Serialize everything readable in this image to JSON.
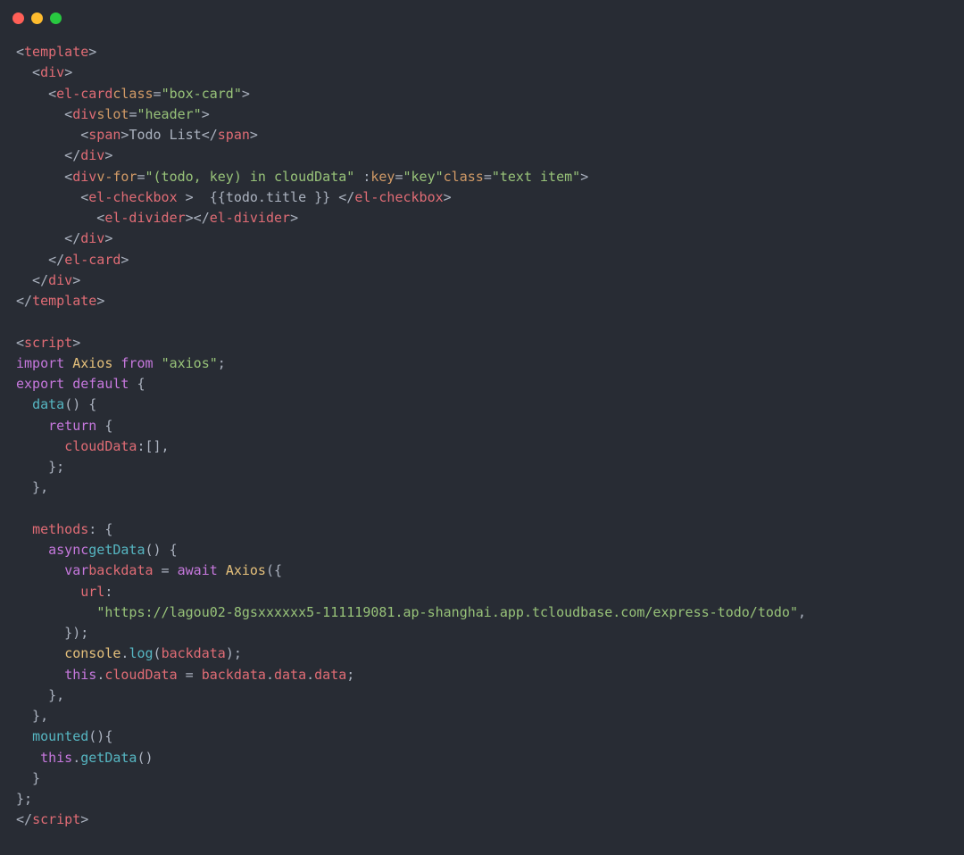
{
  "code": {
    "lines": [
      [
        [
          "p",
          "<"
        ],
        [
          "tag",
          "template"
        ],
        [
          "p",
          ">"
        ]
      ],
      [
        [
          "p",
          "  <"
        ],
        [
          "tag",
          "div"
        ],
        [
          "p",
          ">"
        ]
      ],
      [
        [
          "p",
          "    <"
        ],
        [
          "tag",
          "el-card"
        ],
        [
          "attr",
          "class"
        ],
        [
          "p",
          "="
        ],
        [
          "str",
          "\"box-card\""
        ],
        [
          "p",
          ">"
        ]
      ],
      [
        [
          "p",
          "      <"
        ],
        [
          "tag",
          "div"
        ],
        [
          "attr",
          "slot"
        ],
        [
          "p",
          "="
        ],
        [
          "str",
          "\"header\""
        ],
        [
          "p",
          ">"
        ]
      ],
      [
        [
          "p",
          "        <"
        ],
        [
          "tag",
          "span"
        ],
        [
          "p",
          ">"
        ],
        [
          "txt",
          "Todo List"
        ],
        [
          "p",
          "</"
        ],
        [
          "tag",
          "span"
        ],
        [
          "p",
          ">"
        ]
      ],
      [
        [
          "p",
          "      </"
        ],
        [
          "tag",
          "div"
        ],
        [
          "p",
          ">"
        ]
      ],
      [
        [
          "p",
          "      <"
        ],
        [
          "tag",
          "div"
        ],
        [
          "attr",
          "v-for"
        ],
        [
          "p",
          "="
        ],
        [
          "str",
          "\"(todo, key) in cloudData\""
        ],
        [
          "p",
          " :"
        ],
        [
          "attr",
          "key"
        ],
        [
          "p",
          "="
        ],
        [
          "str",
          "\"key\""
        ],
        [
          "attr",
          "class"
        ],
        [
          "p",
          "="
        ],
        [
          "str",
          "\"text item\""
        ],
        [
          "p",
          ">"
        ]
      ],
      [
        [
          "p",
          "        <"
        ],
        [
          "tag",
          "el-checkbox"
        ],
        [
          "p",
          " >  {{"
        ],
        [
          "txt",
          "todo.title"
        ],
        [
          "p",
          " }} </"
        ],
        [
          "tag",
          "el-checkbox"
        ],
        [
          "p",
          ">"
        ]
      ],
      [
        [
          "p",
          "          <"
        ],
        [
          "tag",
          "el-divider"
        ],
        [
          "p",
          "></"
        ],
        [
          "tag",
          "el-divider"
        ],
        [
          "p",
          ">"
        ]
      ],
      [
        [
          "p",
          "      </"
        ],
        [
          "tag",
          "div"
        ],
        [
          "p",
          ">"
        ]
      ],
      [
        [
          "p",
          "    </"
        ],
        [
          "tag",
          "el-card"
        ],
        [
          "p",
          ">"
        ]
      ],
      [
        [
          "p",
          "  </"
        ],
        [
          "tag",
          "div"
        ],
        [
          "p",
          ">"
        ]
      ],
      [
        [
          "p",
          "</"
        ],
        [
          "tag",
          "template"
        ],
        [
          "p",
          ">"
        ]
      ],
      [
        [
          "p",
          ""
        ]
      ],
      [
        [
          "p",
          "<"
        ],
        [
          "tag",
          "script"
        ],
        [
          "p",
          ">"
        ]
      ],
      [
        [
          "kw",
          "import"
        ],
        [
          "p",
          " "
        ],
        [
          "obj",
          "Axios"
        ],
        [
          "p",
          " "
        ],
        [
          "kw",
          "from"
        ],
        [
          "p",
          " "
        ],
        [
          "str",
          "\"axios\""
        ],
        [
          "p",
          ";"
        ]
      ],
      [
        [
          "kw",
          "export"
        ],
        [
          "p",
          " "
        ],
        [
          "kw",
          "default"
        ],
        [
          "p",
          " {"
        ]
      ],
      [
        [
          "p",
          "  "
        ],
        [
          "fn",
          "data"
        ],
        [
          "p",
          "() {"
        ]
      ],
      [
        [
          "p",
          "    "
        ],
        [
          "kw",
          "return"
        ],
        [
          "p",
          " {"
        ]
      ],
      [
        [
          "p",
          "      "
        ],
        [
          "var",
          "cloudData"
        ],
        [
          "p",
          ":[],"
        ]
      ],
      [
        [
          "p",
          "    };"
        ]
      ],
      [
        [
          "p",
          "  },"
        ]
      ],
      [
        [
          "p",
          ""
        ]
      ],
      [
        [
          "p",
          "  "
        ],
        [
          "var",
          "methods"
        ],
        [
          "p",
          ": {"
        ]
      ],
      [
        [
          "p",
          "    "
        ],
        [
          "kw",
          "async"
        ],
        [
          "fn",
          "getData"
        ],
        [
          "p",
          "() {"
        ]
      ],
      [
        [
          "p",
          "      "
        ],
        [
          "kw",
          "var"
        ],
        [
          "var",
          "backdata"
        ],
        [
          "p",
          " = "
        ],
        [
          "kw",
          "await"
        ],
        [
          "p",
          " "
        ],
        [
          "obj",
          "Axios"
        ],
        [
          "p",
          "({"
        ]
      ],
      [
        [
          "p",
          "        "
        ],
        [
          "var",
          "url"
        ],
        [
          "p",
          ":"
        ]
      ],
      [
        [
          "p",
          "          "
        ],
        [
          "str",
          "\"https://lagou02-8gsxxxxxx5-111119081.ap-shanghai.app.tcloudbase.com/express-todo/todo\""
        ],
        [
          "p",
          ","
        ]
      ],
      [
        [
          "p",
          "      });"
        ]
      ],
      [
        [
          "p",
          "      "
        ],
        [
          "obj",
          "console"
        ],
        [
          "p",
          "."
        ],
        [
          "fn",
          "log"
        ],
        [
          "p",
          "("
        ],
        [
          "var",
          "backdata"
        ],
        [
          "p",
          ");"
        ]
      ],
      [
        [
          "p",
          "      "
        ],
        [
          "kw",
          "this"
        ],
        [
          "p",
          "."
        ],
        [
          "var",
          "cloudData"
        ],
        [
          "p",
          " = "
        ],
        [
          "var",
          "backdata"
        ],
        [
          "p",
          "."
        ],
        [
          "var",
          "data"
        ],
        [
          "p",
          "."
        ],
        [
          "var",
          "data"
        ],
        [
          "p",
          ";"
        ]
      ],
      [
        [
          "p",
          "    },"
        ]
      ],
      [
        [
          "p",
          "  },"
        ]
      ],
      [
        [
          "p",
          "  "
        ],
        [
          "fn",
          "mounted"
        ],
        [
          "p",
          "(){"
        ]
      ],
      [
        [
          "p",
          "   "
        ],
        [
          "kw",
          "this"
        ],
        [
          "p",
          "."
        ],
        [
          "fn",
          "getData"
        ],
        [
          "p",
          "()"
        ]
      ],
      [
        [
          "p",
          "  }"
        ]
      ],
      [
        [
          "p",
          "};"
        ]
      ],
      [
        [
          "p",
          "</"
        ],
        [
          "tag",
          "script"
        ],
        [
          "p",
          ">"
        ]
      ]
    ]
  },
  "traffic_lights": {
    "red": "#ff5f57",
    "yellow": "#febc2e",
    "green": "#28c840"
  }
}
